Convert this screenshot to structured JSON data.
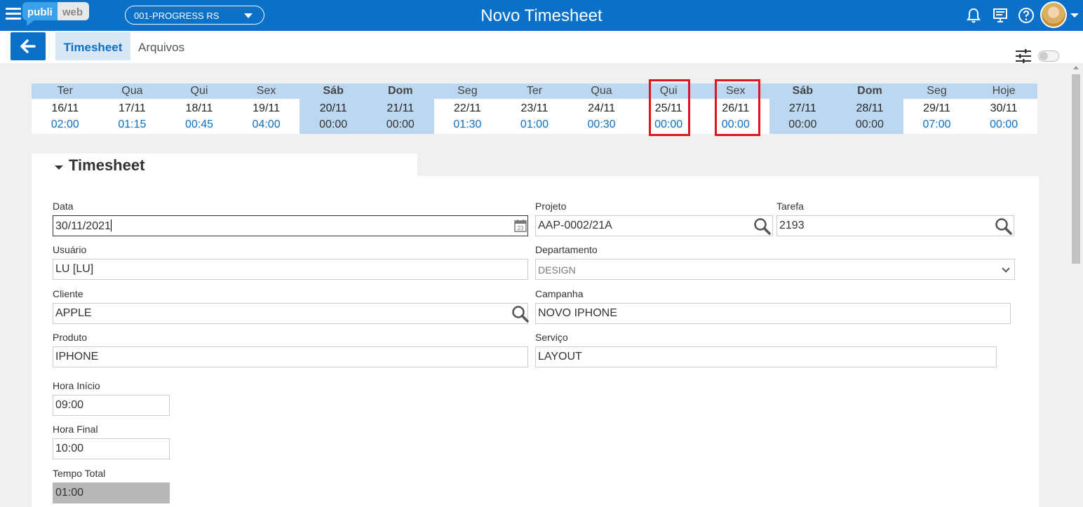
{
  "header": {
    "logo_left": "publi",
    "logo_right": "web",
    "company": "001-PROGRESS RS",
    "title": "Novo Timesheet",
    "icons": [
      "bell-icon",
      "monitor-icon",
      "help-icon",
      "avatar"
    ]
  },
  "subbar": {
    "tabs": [
      {
        "label": "Timesheet",
        "active": true
      },
      {
        "label": "Arquivos",
        "active": false
      }
    ]
  },
  "calendar": {
    "days": [
      {
        "name": "Ter",
        "date": "16/11",
        "hours": "02:00",
        "weekend": false,
        "highlighted": false
      },
      {
        "name": "Qua",
        "date": "17/11",
        "hours": "01:15",
        "weekend": false,
        "highlighted": false
      },
      {
        "name": "Qui",
        "date": "18/11",
        "hours": "00:45",
        "weekend": false,
        "highlighted": false
      },
      {
        "name": "Sex",
        "date": "19/11",
        "hours": "04:00",
        "weekend": false,
        "highlighted": false
      },
      {
        "name": "Sáb",
        "date": "20/11",
        "hours": "00:00",
        "weekend": true,
        "highlighted": false
      },
      {
        "name": "Dom",
        "date": "21/11",
        "hours": "00:00",
        "weekend": true,
        "highlighted": false
      },
      {
        "name": "Seg",
        "date": "22/11",
        "hours": "01:30",
        "weekend": false,
        "highlighted": false
      },
      {
        "name": "Ter",
        "date": "23/11",
        "hours": "01:00",
        "weekend": false,
        "highlighted": false
      },
      {
        "name": "Qua",
        "date": "24/11",
        "hours": "00:30",
        "weekend": false,
        "highlighted": false
      },
      {
        "name": "Qui",
        "date": "25/11",
        "hours": "00:00",
        "weekend": false,
        "highlighted": true
      },
      {
        "name": "Sex",
        "date": "26/11",
        "hours": "00:00",
        "weekend": false,
        "highlighted": true
      },
      {
        "name": "Sáb",
        "date": "27/11",
        "hours": "00:00",
        "weekend": true,
        "highlighted": false
      },
      {
        "name": "Dom",
        "date": "28/11",
        "hours": "00:00",
        "weekend": true,
        "highlighted": false
      },
      {
        "name": "Seg",
        "date": "29/11",
        "hours": "07:00",
        "weekend": false,
        "highlighted": false
      },
      {
        "name": "Hoje",
        "date": "30/11",
        "hours": "00:00",
        "weekend": false,
        "highlighted": false
      }
    ],
    "highlight_color": "#e0141e"
  },
  "form": {
    "section_title": "Timesheet",
    "data": {
      "label": "Data",
      "value": "30/11/2021"
    },
    "projeto": {
      "label": "Projeto",
      "value": "AAP-0002/21A"
    },
    "tarefa": {
      "label": "Tarefa",
      "value": "2193"
    },
    "usuario": {
      "label": "Usuário",
      "value": "LU [LU]"
    },
    "departamento": {
      "label": "Departamento",
      "value": "DESIGN"
    },
    "cliente": {
      "label": "Cliente",
      "value": "APPLE"
    },
    "campanha": {
      "label": "Campanha",
      "value": "NOVO IPHONE"
    },
    "produto": {
      "label": "Produto",
      "value": "IPHONE"
    },
    "servico": {
      "label": "Serviço",
      "value": "LAYOUT"
    },
    "hora_inicio": {
      "label": "Hora Início",
      "value": "09:00"
    },
    "hora_final": {
      "label": "Hora Final",
      "value": "10:00"
    },
    "tempo_total": {
      "label": "Tempo Total",
      "value": "01:00"
    }
  },
  "colors": {
    "brand": "#0a70c8",
    "calendar_header": "#bcd8f1",
    "readonly_field": "#b9b7b9"
  }
}
